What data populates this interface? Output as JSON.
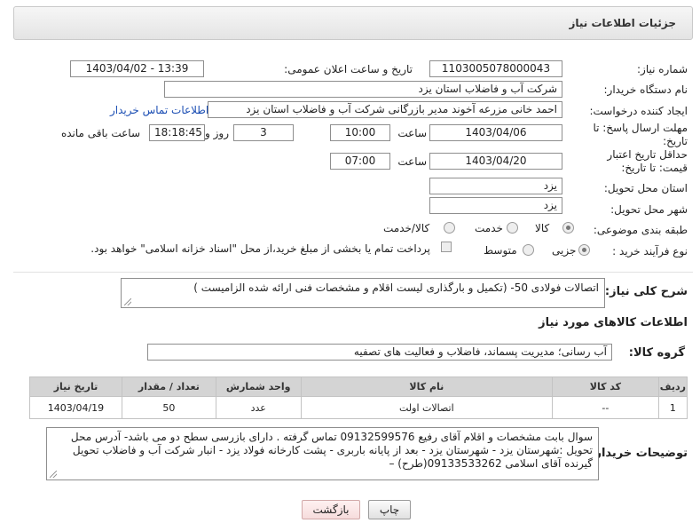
{
  "header": {
    "title": "جزئیات اطلاعات نیاز"
  },
  "labels": {
    "need_number": "شماره نیاز:",
    "announce_datetime": "تاریخ و ساعت اعلان عمومی:",
    "buyer_org": "نام دستگاه خریدار:",
    "requester": "ایجاد کننده درخواست:",
    "reply_deadline": "مهلت ارسال پاسخ: تا تاریخ:",
    "time_word": "ساعت",
    "day_and": "روز و",
    "remaining": "ساعت باقی مانده",
    "min_price_validity": "حداقل تاریخ اعتبار قیمت: تا تاریخ:",
    "province": "استان محل تحویل:",
    "city": "شهر محل تحویل:",
    "category": "طبقه بندی موضوعی:",
    "process_type": "نوع فرآیند خرید :",
    "general_desc": "شرح کلی نیاز:",
    "goods_info": "اطلاعات کالاهای مورد نیاز",
    "goods_group": "گروه کالا:",
    "buyer_notes": "توضیحات خریدار:"
  },
  "values": {
    "need_number": "1103005078000043",
    "announce_datetime": "1403/04/02 - 13:39",
    "buyer_org": "شرکت آب و فاضلاب استان یزد",
    "requester": "احمد خانی مزرعه آخوند مدیر بازرگانی شرکت آب و فاضلاب استان یزد",
    "contact_link": "اطلاعات تماس خریدار",
    "reply_date": "1403/04/06",
    "reply_time": "10:00",
    "reply_days": "3",
    "reply_remaining": "18:18:45",
    "validity_date": "1403/04/20",
    "validity_time": "07:00",
    "province": "یزد",
    "city": "یزد",
    "general_desc": "اتصالات فولادی 50-   (تکمیل و بارگذاری لیست اقلام و مشخصات فنی ارائه شده الزامیست )",
    "goods_group": "آب رسانی؛ مدیریت پسماند، فاضلاب و فعالیت های تصفیه",
    "buyer_notes": "سوال بابت مشخصات و اقلام آقای رفیع 09132599576 تماس گرفته . دارای بازرسی سطح دو می باشد- آدرس محل تحویل :شهرستان یزد - شهرستان یزد - بعد از پایانه باربری - پشت کارخانه فولاد یزد - انبار شرکت آب و فاضلاب تحویل گیرنده آقای اسلامی  09133533262(طرح) –"
  },
  "category_options": {
    "goods": "کالا",
    "service": "خدمت",
    "goods_service": "کالا/خدمت"
  },
  "process_options": {
    "partial": "جزیی",
    "medium": "متوسط",
    "treasury_note": "پرداخت تمام یا بخشی از مبلغ خرید،از محل \"اسناد خزانه اسلامی\" خواهد بود."
  },
  "table": {
    "headers": [
      "ردیف",
      "کد کالا",
      "نام کالا",
      "واحد شمارش",
      "تعداد / مقدار",
      "تاریخ نیاز"
    ],
    "rows": [
      [
        "1",
        "--",
        "اتصالات اولت",
        "عدد",
        "50",
        "1403/04/19"
      ]
    ]
  },
  "buttons": {
    "print": "چاپ",
    "back": "بازگشت"
  },
  "colors": {
    "link": "#1a4db3",
    "header_bg": "#e4e4e4",
    "table_header_bg": "#d4d4d4"
  }
}
